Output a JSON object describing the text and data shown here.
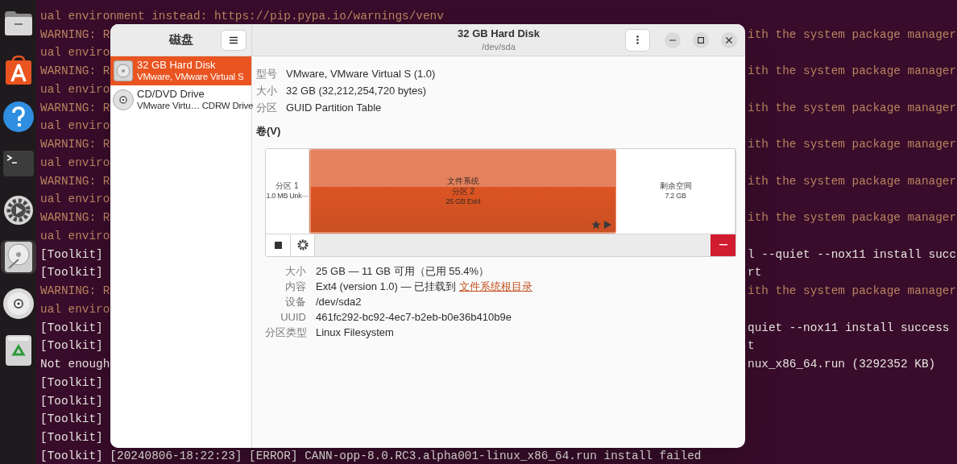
{
  "dock": {
    "items": [
      {
        "kind": "files",
        "selected": false
      },
      {
        "kind": "appstore",
        "selected": false
      },
      {
        "kind": "help",
        "selected": false
      },
      {
        "kind": "terminal",
        "selected": false
      },
      {
        "kind": "settings",
        "selected": false
      },
      {
        "kind": "disks",
        "selected": true
      },
      {
        "kind": "cd",
        "selected": false
      },
      {
        "kind": "trash",
        "selected": false
      }
    ]
  },
  "terminal": {
    "lines": [
      {
        "kind": "warning",
        "text": "ual environment instead: https://pip.pypa.io/warnings/venv"
      },
      {
        "kind": "warning",
        "left": "WARNING: R",
        "right": "ith the system package manager"
      },
      {
        "kind": "warning",
        "left": "ual enviro"
      },
      {
        "kind": "warning",
        "left": "WARNING: R",
        "right": "ith the system package manager"
      },
      {
        "kind": "warning",
        "left": "ual enviro"
      },
      {
        "kind": "warning",
        "left": "WARNING: R",
        "right": "ith the system package manager"
      },
      {
        "kind": "warning",
        "left": "ual enviro"
      },
      {
        "kind": "warning",
        "left": "WARNING: R",
        "right": "ith the system package manager"
      },
      {
        "kind": "warning",
        "left": "ual enviro"
      },
      {
        "kind": "warning",
        "left": "WARNING: R",
        "right": "ith the system package manager"
      },
      {
        "kind": "warning",
        "left": "ual enviro"
      },
      {
        "kind": "warning",
        "left": "WARNING: R",
        "right": "ith the system package manager"
      },
      {
        "kind": "warning",
        "left": "ual enviro"
      },
      {
        "kind": "normal",
        "left": "[Toolkit]",
        "right": "l --quiet --nox11 install succ"
      },
      {
        "kind": "normal",
        "left": "[Toolkit]",
        "right": "rt"
      },
      {
        "kind": "warning",
        "left": "WARNING: R",
        "right": "ith the system package manager"
      },
      {
        "kind": "warning",
        "left": "ual enviro"
      },
      {
        "kind": "normal",
        "left": "[Toolkit]",
        "right": "quiet --nox11 install success"
      },
      {
        "kind": "normal",
        "left": "[Toolkit]",
        "right": "t"
      },
      {
        "kind": "normal",
        "left": "Not enough",
        "right": "nux_x86_64.run (3292352 KB)"
      },
      {
        "kind": "normal",
        "left": "[Toolkit]"
      },
      {
        "kind": "normal",
        "left": "[Toolkit]"
      },
      {
        "kind": "normal",
        "left": "[Toolkit]"
      },
      {
        "kind": "normal",
        "left": "[Toolkit]"
      },
      {
        "kind": "normal",
        "text": "[Toolkit] [20240806-18:22:23] [ERROR] CANN-opp-8.0.RC3.alpha001-linux_x86_64.run install failed"
      }
    ]
  },
  "window": {
    "sidebar": {
      "title": "磁盘",
      "items": [
        {
          "kind": "disk",
          "name": "32 GB Hard Disk",
          "detail": "VMware, VMware Virtual S",
          "selected": true
        },
        {
          "kind": "cd",
          "name": "CD/DVD Drive",
          "detail": "VMware Virtu… CDRW Drive",
          "selected": false
        }
      ]
    },
    "title": "32 GB Hard Disk",
    "subtitle": "/dev/sda",
    "properties": [
      {
        "label": "型号",
        "value": "VMware, VMware Virtual S (1.0)"
      },
      {
        "label": "大小",
        "value": "32 GB (32,212,254,720 bytes)"
      },
      {
        "label": "分区",
        "value": "GUID Partition Table"
      }
    ],
    "volumes_title": "卷(V)",
    "partitions": [
      {
        "kind": "partition",
        "lines": [
          "分区 1",
          "1.0 MB Unk···"
        ],
        "selected": false,
        "system": false,
        "mounted": false
      },
      {
        "kind": "partition",
        "lines": [
          "文件系统",
          "分区 2",
          "25 GB Ext4"
        ],
        "selected": true,
        "system": true,
        "mounted": true
      },
      {
        "kind": "free",
        "lines": [
          "剩余空间",
          "7.2 GB"
        ],
        "selected": false,
        "system": false,
        "mounted": false
      }
    ],
    "details": [
      {
        "label": "大小",
        "value": "25 GB — 11 GB 可用（已用 55.4%）"
      },
      {
        "label": "内容",
        "value": "Ext4 (version 1.0) — 已挂载到",
        "link": "文件系统根目录"
      },
      {
        "label": "设备",
        "value": "/dev/sda2"
      },
      {
        "label": "UUID",
        "value": "461fc292-bc92-4ec7-b2eb-b0e36b410b9e"
      },
      {
        "label": "分区类型",
        "value": "Linux Filesystem"
      }
    ]
  }
}
